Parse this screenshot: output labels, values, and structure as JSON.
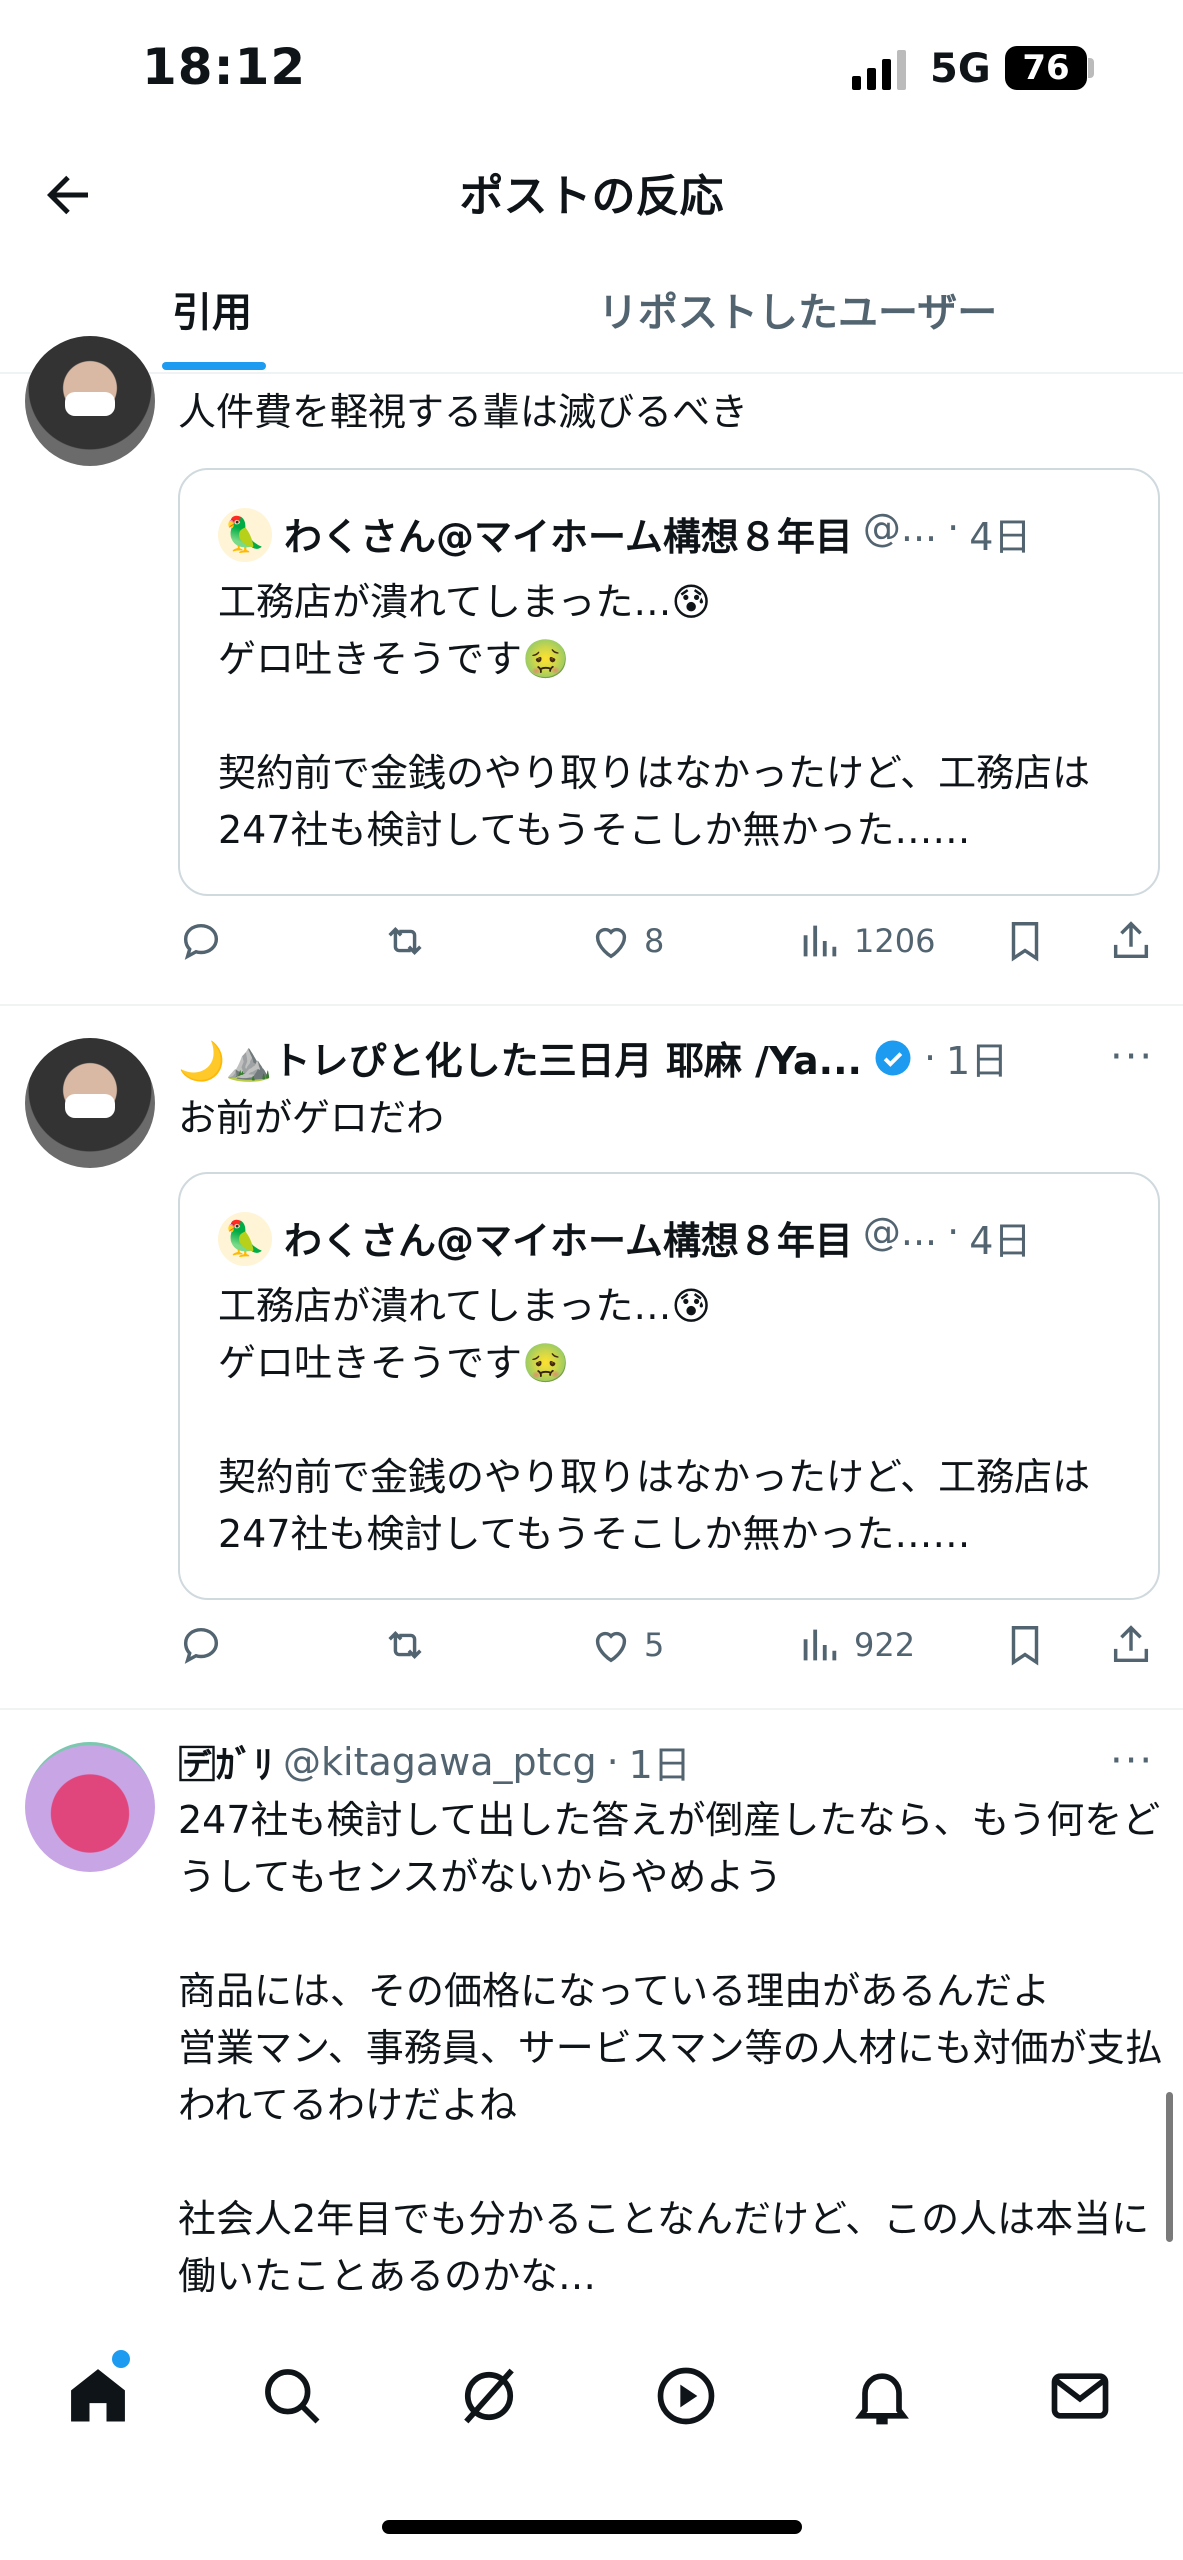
{
  "status": {
    "time": "18:12",
    "network": "5G",
    "battery": "76"
  },
  "header": {
    "title": "ポストの反応"
  },
  "tabs": [
    {
      "label": "引用"
    },
    {
      "label": "リポストしたユーザー"
    }
  ],
  "quoted": {
    "name": "わくさん@マイホーム構想８年目",
    "handle": "@...",
    "time": "4日",
    "text": "工務店が潰れてしまった…😰\nゲロ吐きそうです🤢\n\n契約前で金銭のやり取りはなかったけど、工務店は247社も検討してもうそこしか無かった……"
  },
  "posts": [
    {
      "text": "人件費を軽視する輩は滅びるべき",
      "likes": "8",
      "views": "1206"
    },
    {
      "name": "🌙⛰️トレぴと化した三日月 耶麻 /Ya...",
      "time": "1日",
      "more": "···",
      "text": "お前がゲロだわ",
      "likes": "5",
      "views": "922"
    },
    {
      "name": "🈓ｶﾞﾘ",
      "handle": "@kitagawa_ptcg",
      "time": "1日",
      "more": "···",
      "text": "247社も検討して出した答えが倒産したなら、もう何をどうしてもセンスがないからやめよう\n\n商品には、その価格になっている理由があるんだよ\n営業マン、事務員、サービスマン等の人材にも対価が支払われてるわけだよね\n\n社会人2年目でも分かることなんだけど、この人は本当に働いたことあるのかな…"
    }
  ],
  "icons": {
    "back": "arrow-left-icon",
    "reply": "reply-icon",
    "repost": "repost-icon",
    "like": "heart-icon",
    "views": "views-icon",
    "bookmark": "bookmark-icon",
    "share": "share-icon",
    "verified": "verified-badge-icon",
    "nav": [
      "home-icon",
      "search-icon",
      "grok-icon",
      "video-icon",
      "bell-icon",
      "mail-icon"
    ]
  },
  "colors": {
    "accent": "#1d9bf0",
    "muted": "#536471",
    "text": "#0f1419"
  }
}
